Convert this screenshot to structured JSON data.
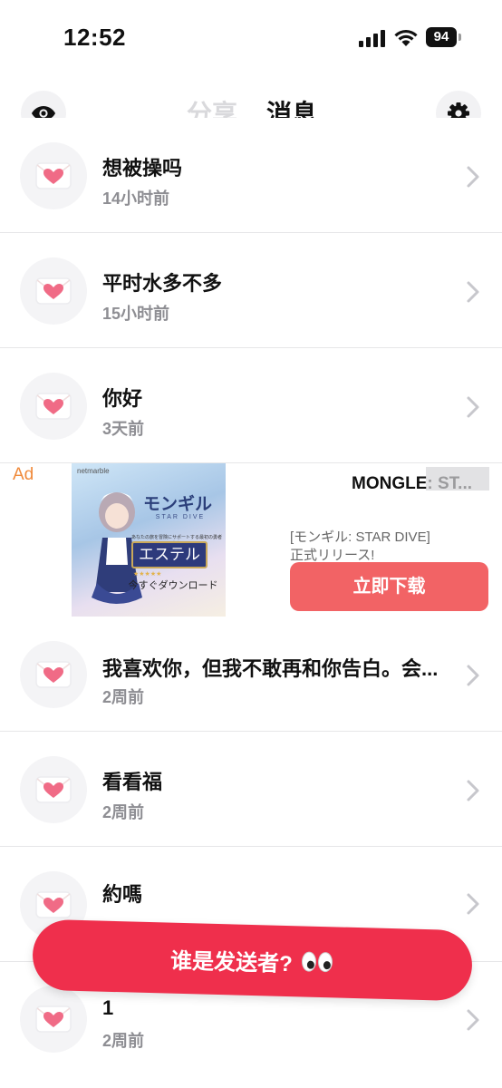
{
  "status_bar": {
    "time": "12:52",
    "battery": "94"
  },
  "header": {
    "tab_share": "分享",
    "tab_messages": "消息"
  },
  "messages": [
    {
      "title": "想被操吗",
      "time": "14小时前"
    },
    {
      "title": "平时水多不多",
      "time": "15小时前"
    },
    {
      "title": "你好",
      "time": "3天前"
    },
    {
      "title": "我喜欢你，但我不敢再和你告白。会...",
      "time": "2周前"
    },
    {
      "title": "看看福",
      "time": "2周前"
    },
    {
      "title": "約嗎",
      "time": ""
    },
    {
      "title": "1",
      "time": "2周前"
    }
  ],
  "ad": {
    "label": "Ad",
    "title": "MONGLE: ST...",
    "description_line1": "[モンギル: STAR DIVE]",
    "description_line2": "正式リリース!",
    "button": "立即下载",
    "image": {
      "brand": "netmarble",
      "logo": "モンギル",
      "logo_sub": "STAR DIVE",
      "tagline": "あなたの旅を冒険にサポートする最初の勇者たち",
      "character_name": "エステル",
      "cta": "今すぐダウンロード"
    }
  },
  "floating_button": {
    "label": "谁是发送者?"
  },
  "colors": {
    "accent_red": "#ef2f4c",
    "ad_button": "#f26365",
    "ad_label": "#f08a3a",
    "muted_text": "#8e8e93"
  },
  "icons": [
    "eye-icon",
    "gear-icon",
    "heart-envelope-icon",
    "chevron-right-icon",
    "eyes-emoji-icon"
  ]
}
